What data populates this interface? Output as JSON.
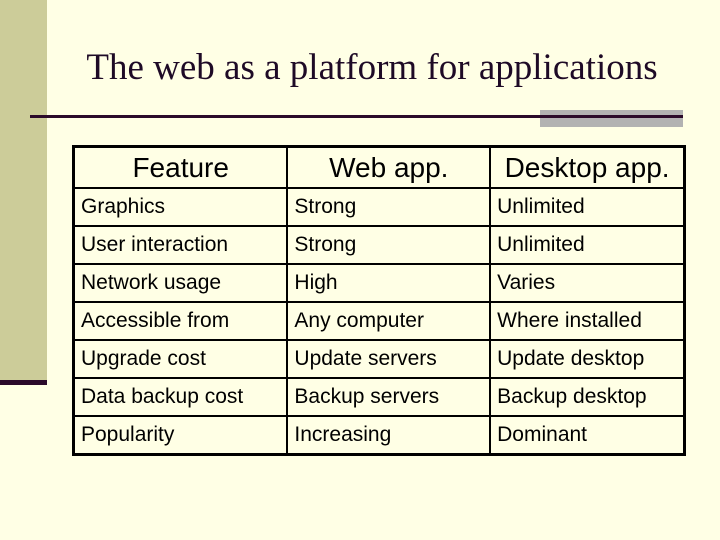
{
  "slide": {
    "title": "The web as a platform for applications",
    "colors": {
      "background": "#ffffe5",
      "side_bar": "#cccc99",
      "rule": "#2b0a2a",
      "accent": "#b2b2b2"
    }
  },
  "table": {
    "headers": [
      "Feature",
      "Web app.",
      "Desktop app."
    ],
    "rows": [
      [
        "Graphics",
        "Strong",
        "Unlimited"
      ],
      [
        "User interaction",
        "Strong",
        "Unlimited"
      ],
      [
        "Network usage",
        "High",
        "Varies"
      ],
      [
        "Accessible from",
        "Any computer",
        "Where installed"
      ],
      [
        "Upgrade cost",
        "Update servers",
        "Update desktop"
      ],
      [
        "Data backup cost",
        "Backup servers",
        "Backup desktop"
      ],
      [
        "Popularity",
        "Increasing",
        "Dominant"
      ]
    ]
  }
}
